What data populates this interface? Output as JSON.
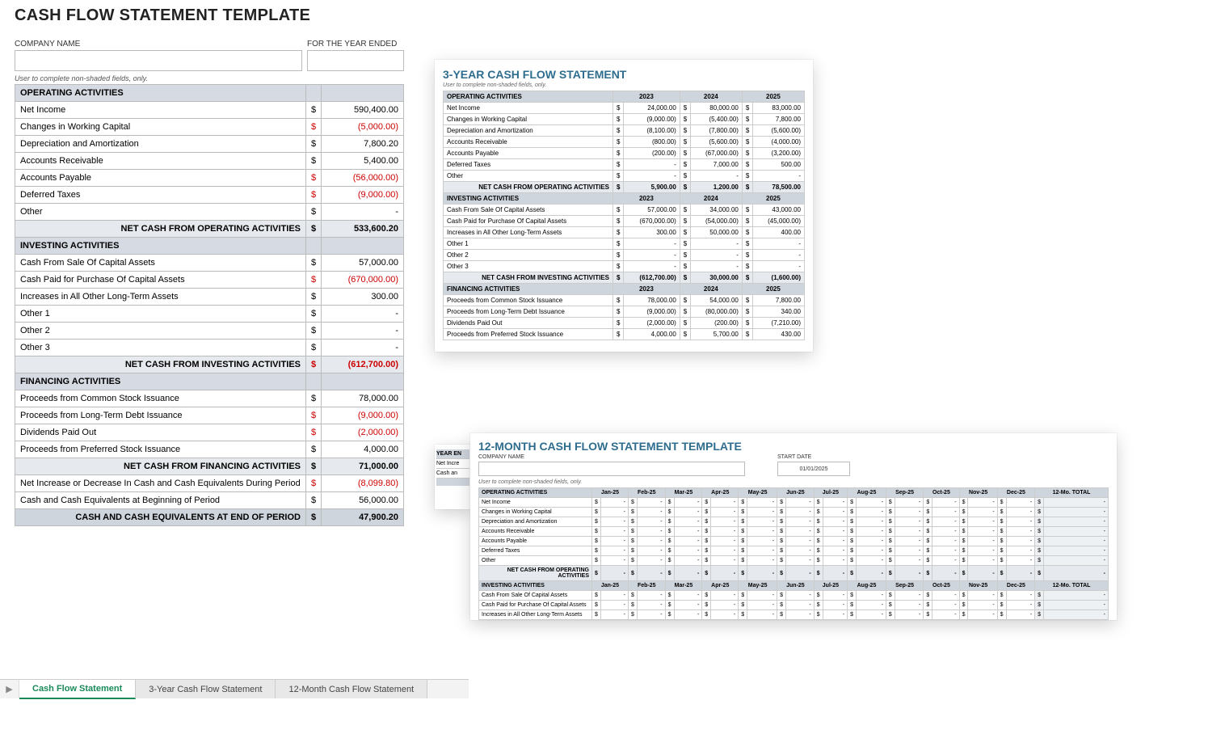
{
  "main": {
    "title": "CASH FLOW STATEMENT TEMPLATE",
    "company_label": "COMPANY NAME",
    "year_label": "FOR THE YEAR ENDED",
    "note": "User to complete non-shaded fields, only.",
    "sections": [
      {
        "header": "OPERATING ACTIVITIES",
        "rows": [
          {
            "label": "Net Income",
            "dollar": "$",
            "amt": "590,400.00"
          },
          {
            "label": "Changes in Working Capital",
            "dollar": "$",
            "amt": "(5,000.00)",
            "neg": true
          },
          {
            "label": "Depreciation and Amortization",
            "dollar": "$",
            "amt": "7,800.20"
          },
          {
            "label": "Accounts Receivable",
            "dollar": "$",
            "amt": "5,400.00"
          },
          {
            "label": "Accounts Payable",
            "dollar": "$",
            "amt": "(56,000.00)",
            "neg": true
          },
          {
            "label": "Deferred Taxes",
            "dollar": "$",
            "amt": "(9,000.00)",
            "neg": true
          },
          {
            "label": "Other",
            "dollar": "$",
            "amt": "-"
          }
        ],
        "subtotal": {
          "label": "NET CASH FROM OPERATING ACTIVITIES",
          "dollar": "$",
          "amt": "533,600.20"
        }
      },
      {
        "header": "INVESTING ACTIVITIES",
        "rows": [
          {
            "label": "Cash From Sale Of Capital Assets",
            "dollar": "$",
            "amt": "57,000.00"
          },
          {
            "label": "Cash Paid for Purchase Of Capital Assets",
            "dollar": "$",
            "amt": "(670,000.00)",
            "neg": true
          },
          {
            "label": "Increases in All Other Long-Term Assets",
            "dollar": "$",
            "amt": "300.00"
          },
          {
            "label": "Other 1",
            "dollar": "$",
            "amt": "-"
          },
          {
            "label": "Other 2",
            "dollar": "$",
            "amt": "-"
          },
          {
            "label": "Other 3",
            "dollar": "$",
            "amt": "-"
          }
        ],
        "subtotal": {
          "label": "NET CASH FROM INVESTING ACTIVITIES",
          "dollar": "$",
          "amt": "(612,700.00)",
          "neg": true
        }
      },
      {
        "header": "FINANCING ACTIVITIES",
        "rows": [
          {
            "label": "Proceeds from Common Stock Issuance",
            "dollar": "$",
            "amt": "78,000.00"
          },
          {
            "label": "Proceeds from Long-Term Debt Issuance",
            "dollar": "$",
            "amt": "(9,000.00)",
            "neg": true
          },
          {
            "label": "Dividends Paid Out",
            "dollar": "$",
            "amt": "(2,000.00)",
            "neg": true
          },
          {
            "label": "Proceeds from Preferred Stock Issuance",
            "dollar": "$",
            "amt": "4,000.00"
          }
        ],
        "subtotal": {
          "label": "NET CASH FROM FINANCING ACTIVITIES",
          "dollar": "$",
          "amt": "71,000.00"
        }
      }
    ],
    "footer": [
      {
        "label": "Net Increase or Decrease In Cash and Cash Equivalents During Period",
        "dollar": "$",
        "amt": "(8,099.80)",
        "neg": true
      },
      {
        "label": "Cash and Cash Equivalents at Beginning of Period",
        "dollar": "$",
        "amt": "56,000.00"
      }
    ],
    "grand": {
      "label": "CASH AND CASH EQUIVALENTS AT END OF PERIOD",
      "dollar": "$",
      "amt": "47,900.20"
    }
  },
  "three_year": {
    "title": "3-YEAR CASH FLOW STATEMENT",
    "note": "User to complete non-shaded fields, only.",
    "years": [
      "2023",
      "2024",
      "2025"
    ],
    "sections": [
      {
        "header": "OPERATING ACTIVITIES",
        "rows": [
          {
            "label": "Net Income",
            "vals": [
              "24,000.00",
              "80,000.00",
              "83,000.00"
            ]
          },
          {
            "label": "Changes in Working Capital",
            "vals": [
              "(9,000.00)",
              "(5,400.00)",
              "7,800.00"
            ],
            "neg": [
              true,
              true,
              false
            ]
          },
          {
            "label": "Depreciation and Amortization",
            "vals": [
              "(8,100.00)",
              "(7,800.00)",
              "(5,600.00)"
            ],
            "neg": [
              true,
              true,
              true
            ]
          },
          {
            "label": "Accounts Receivable",
            "vals": [
              "(800.00)",
              "(5,600.00)",
              "(4,000.00)"
            ],
            "neg": [
              true,
              true,
              true
            ]
          },
          {
            "label": "Accounts Payable",
            "vals": [
              "(200.00)",
              "(67,000.00)",
              "(3,200.00)"
            ],
            "neg": [
              true,
              true,
              true
            ]
          },
          {
            "label": "Deferred Taxes",
            "vals": [
              "-",
              "7,000.00",
              "500.00"
            ]
          },
          {
            "label": "Other",
            "vals": [
              "-",
              "-",
              "-"
            ]
          }
        ],
        "subtotal": {
          "label": "NET CASH FROM OPERATING ACTIVITIES",
          "vals": [
            "5,900.00",
            "1,200.00",
            "78,500.00"
          ]
        }
      },
      {
        "header": "INVESTING ACTIVITIES",
        "rows": [
          {
            "label": "Cash From Sale Of Capital Assets",
            "vals": [
              "57,000.00",
              "34,000.00",
              "43,000.00"
            ]
          },
          {
            "label": "Cash Paid for Purchase Of Capital Assets",
            "vals": [
              "(670,000.00)",
              "(54,000.00)",
              "(45,000.00)"
            ],
            "neg": [
              true,
              true,
              true
            ]
          },
          {
            "label": "Increases in All Other Long-Term Assets",
            "vals": [
              "300.00",
              "50,000.00",
              "400.00"
            ]
          },
          {
            "label": "Other 1",
            "vals": [
              "-",
              "-",
              "-"
            ]
          },
          {
            "label": "Other 2",
            "vals": [
              "-",
              "-",
              "-"
            ]
          },
          {
            "label": "Other 3",
            "vals": [
              "-",
              "-",
              "-"
            ]
          }
        ],
        "subtotal": {
          "label": "NET CASH FROM INVESTING ACTIVITIES",
          "vals": [
            "(612,700.00)",
            "30,000.00",
            "(1,600.00)"
          ],
          "neg": [
            true,
            false,
            true
          ]
        }
      },
      {
        "header": "FINANCING ACTIVITIES",
        "rows": [
          {
            "label": "Proceeds from Common Stock Issuance",
            "vals": [
              "78,000.00",
              "54,000.00",
              "7,800.00"
            ]
          },
          {
            "label": "Proceeds from Long-Term Debt Issuance",
            "vals": [
              "(9,000.00)",
              "(80,000.00)",
              "340.00"
            ],
            "neg": [
              true,
              true,
              false
            ]
          },
          {
            "label": "Dividends Paid Out",
            "vals": [
              "(2,000.00)",
              "(200.00)",
              "(7,210.00)"
            ],
            "neg": [
              true,
              true,
              true
            ]
          },
          {
            "label": "Proceeds from Preferred Stock Issuance",
            "vals": [
              "4,000.00",
              "5,700.00",
              "430.00"
            ]
          }
        ]
      }
    ],
    "stub": {
      "hdr": "YEAR EN",
      "r1": "Net Incre",
      "r2": "Cash an"
    }
  },
  "twelve_month": {
    "title": "12-MONTH CASH FLOW STATEMENT TEMPLATE",
    "company_label": "COMPANY NAME",
    "start_label": "START DATE",
    "start_date": "01/01/2025",
    "note": "User to complete non-shaded fields, only.",
    "months": [
      "Jan-25",
      "Feb-25",
      "Mar-25",
      "Apr-25",
      "May-25",
      "Jun-25",
      "Jul-25",
      "Aug-25",
      "Sep-25",
      "Oct-25",
      "Nov-25",
      "Dec-25"
    ],
    "total_label": "12-Mo. TOTAL",
    "op_header": "OPERATING ACTIVITIES",
    "op_rows": [
      "Net Income",
      "Changes in Working Capital",
      "Depreciation and Amortization",
      "Accounts Receivable",
      "Accounts Payable",
      "Deferred Taxes",
      "Other"
    ],
    "op_subtotal": "NET CASH FROM OPERATING ACTIVITIES",
    "inv_header": "INVESTING ACTIVITIES",
    "inv_rows": [
      "Cash From Sale Of Capital Assets",
      "Cash Paid for Purchase Of Capital Assets",
      "Increases in All Other Long-Term Assets"
    ]
  },
  "tabs": {
    "arrow": "▶",
    "items": [
      {
        "label": "Cash Flow Statement",
        "active": true
      },
      {
        "label": "3-Year Cash Flow Statement"
      },
      {
        "label": "12-Month Cash Flow Statement"
      }
    ]
  }
}
